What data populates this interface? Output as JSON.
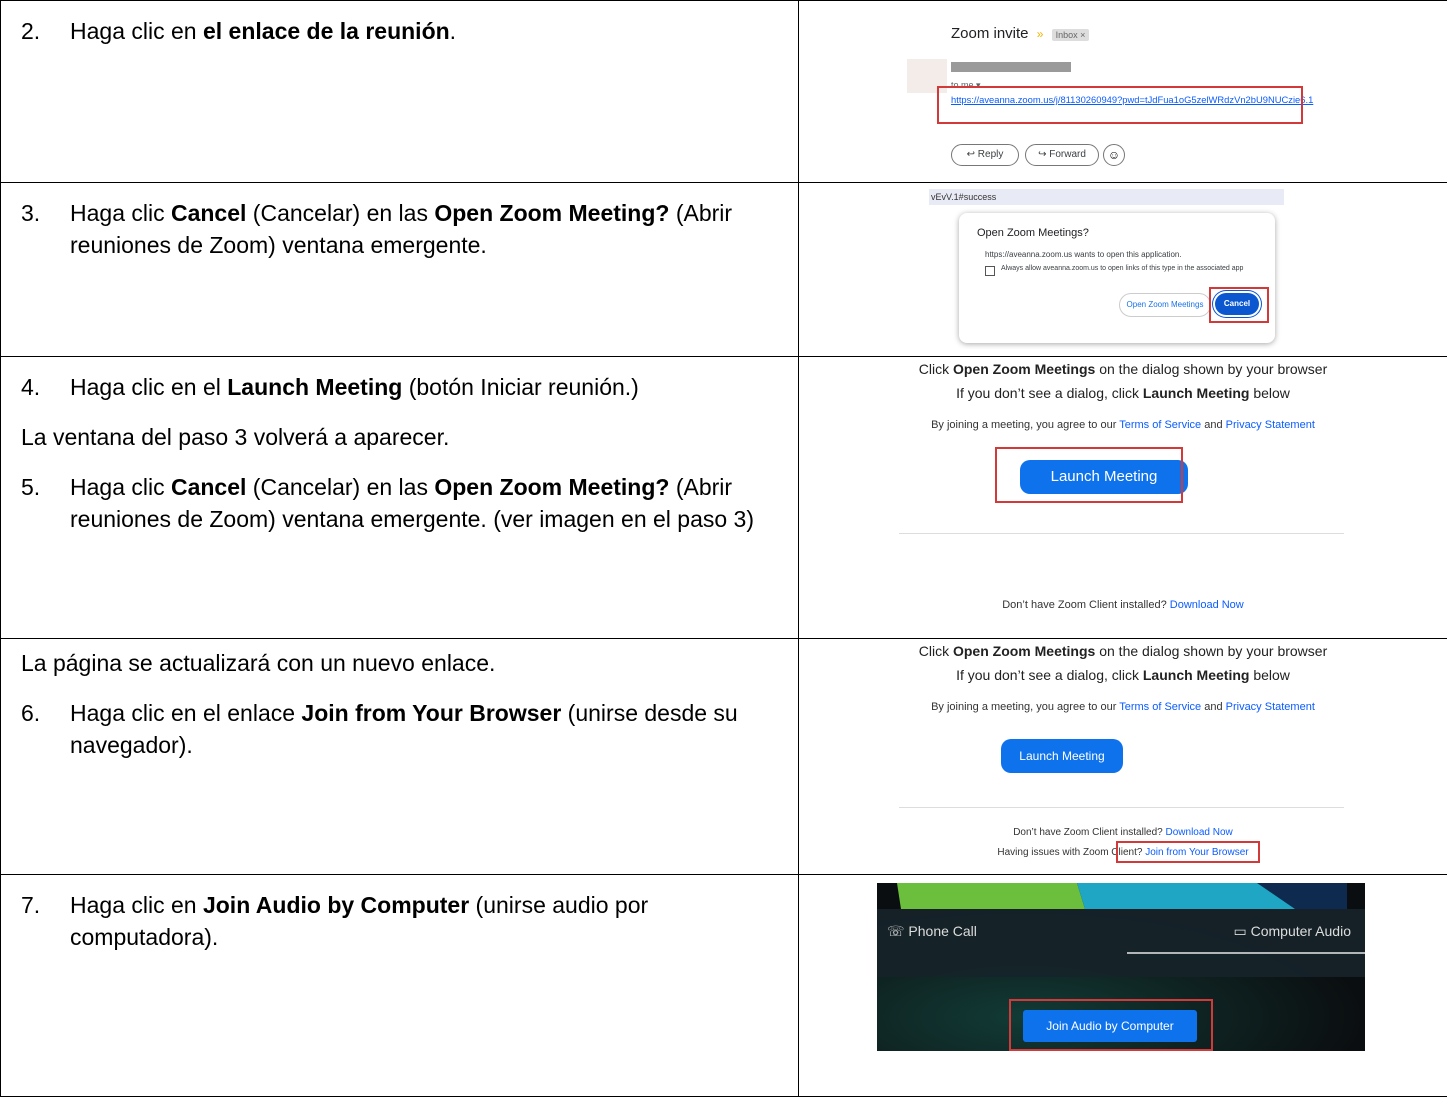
{
  "rows": [
    {
      "step_num": "2.",
      "text_pre": "Haga clic en ",
      "text_bold": "el enlace de la reunión",
      "text_post": ".",
      "shot": {
        "subject": "Zoom invite",
        "inbox_badge": "Inbox ×",
        "to_me": "to me ▾",
        "link": "https://aveanna.zoom.us/j/81130260949?pwd=tJdFua1oG5zelWRdzVn2bU9NUCzie6.1",
        "reply_label": "Reply",
        "forward_label": "Forward"
      }
    },
    {
      "step_num": "3.",
      "text_pre": "Haga clic ",
      "text_bold": "Cancel",
      "text_mid": " (Cancelar) en las ",
      "text_bold2": "Open Zoom Meeting?",
      "text_post": " (Abrir reuniones de Zoom) ventana emergente.",
      "shot": {
        "url_fragment": "vEvV.1#success",
        "dialog_title": "Open Zoom Meetings?",
        "dialog_msg": "https://aveanna.zoom.us wants to open this application.",
        "checkbox_label": "Always allow aveanna.zoom.us to open links of this type in the associated app",
        "open_label": "Open Zoom Meetings",
        "cancel_label": "Cancel"
      }
    },
    {
      "step4_num": "4.",
      "step4_pre": "Haga clic en el ",
      "step4_bold": "Launch Meeting",
      "step4_post": " (botón Iniciar reunión.)",
      "mid_text": "La ventana del paso 3 volverá a aparecer.",
      "step5_num": "5.",
      "step5_pre": "Haga clic ",
      "step5_bold": "Cancel",
      "step5_mid": " (Cancelar) en las ",
      "step5_bold2": "Open Zoom Meeting?",
      "step5_post": " (Abrir reuniones de Zoom) ventana emergente.  (ver imagen en el paso 3)",
      "shot": {
        "line1_pre": "Click ",
        "line1_bold": "Open Zoom Meetings",
        "line1_post": " on the dialog shown by your browser",
        "line2_pre": "If you don’t see a dialog, click ",
        "line2_bold": "Launch Meeting",
        "line2_post": " below",
        "terms_pre": "By joining a meeting, you agree to our ",
        "terms_link": "Terms of Service",
        "terms_and": " and ",
        "privacy_link": "Privacy Statement",
        "launch_label": "Launch Meeting",
        "client_q": "Don’t have Zoom Client installed? ",
        "download_link": "Download Now"
      }
    },
    {
      "intro": "La página se actualizará con un nuevo enlace.",
      "step_num": "6.",
      "text_pre": "Haga clic en el enlace ",
      "text_bold": "Join from Your Browser",
      "text_post": " (unirse desde su navegador).",
      "shot": {
        "line1_pre": "Click ",
        "line1_bold": "Open Zoom Meetings",
        "line1_post": " on the dialog shown by your browser",
        "line2_pre": "If you don’t see a dialog, click ",
        "line2_bold": "Launch Meeting",
        "line2_post": " below",
        "terms_pre": "By joining a meeting, you agree to our ",
        "terms_link": "Terms of Service",
        "terms_and": " and ",
        "privacy_link": "Privacy Statement",
        "launch_label": "Launch Meeting",
        "client_q": "Don’t have Zoom Client installed? ",
        "download_link": "Download Now",
        "issues_q": "Having issues with Zoom Client? ",
        "browser_link": "Join from Your Browser"
      }
    },
    {
      "step_num": "7.",
      "text_pre": "Haga clic en ",
      "text_bold": "Join Audio by Computer",
      "text_post": " (unirse audio por computadora).",
      "shot": {
        "phone_label": "Phone Call",
        "computer_label": "Computer Audio",
        "join_label": "Join Audio by Computer"
      }
    }
  ]
}
